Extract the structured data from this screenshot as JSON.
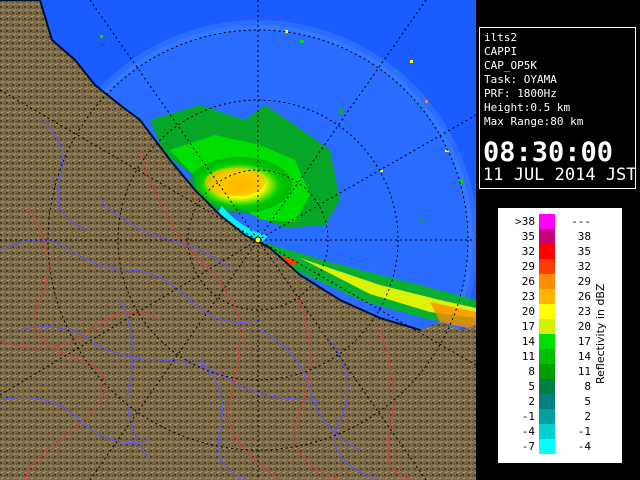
{
  "info": {
    "lines": [
      "ilts2",
      "CAPPI",
      "CAP_OP5K",
      "Task: OYAMA",
      "PRF: 1800Hz",
      "Height:0.5 km",
      "Max Range:80 km"
    ],
    "time": "08:30:00",
    "date": "11 JUL 2014 JST"
  },
  "legend": {
    "unit_label": "Reflectivity in dBZ",
    "rows": [
      {
        "lo": ">38",
        "hi": "---",
        "color": "#ff00ff"
      },
      {
        "lo": "35",
        "hi": "38",
        "color": "#c8007a"
      },
      {
        "lo": "32",
        "hi": "35",
        "color": "#ff0000"
      },
      {
        "lo": "29",
        "hi": "32",
        "color": "#ff3c00"
      },
      {
        "lo": "26",
        "hi": "29",
        "color": "#ff8c00"
      },
      {
        "lo": "23",
        "hi": "26",
        "color": "#ffb400"
      },
      {
        "lo": "20",
        "hi": "23",
        "color": "#ffff00"
      },
      {
        "lo": "17",
        "hi": "20",
        "color": "#d2f000"
      },
      {
        "lo": "14",
        "hi": "17",
        "color": "#00e000"
      },
      {
        "lo": "11",
        "hi": "14",
        "color": "#00c000"
      },
      {
        "lo": "8",
        "hi": "11",
        "color": "#00a000"
      },
      {
        "lo": "5",
        "hi": "8",
        "color": "#008040"
      },
      {
        "lo": "2",
        "hi": "5",
        "color": "#008080"
      },
      {
        "lo": "-1",
        "hi": "2",
        "color": "#00a0a0"
      },
      {
        "lo": "-4",
        "hi": "-1",
        "color": "#00d0d0"
      },
      {
        "lo": "-7",
        "hi": "-4",
        "color": "#00ffff"
      }
    ]
  },
  "colors": {
    "sea_outer": "#1a5cff",
    "sea_inner": "#2a6cff",
    "land": "#7a6a4a",
    "land_dark": "#4a3a22",
    "rivers": "#5a55ff",
    "borders": "#d04040",
    "coast": "#001030"
  }
}
